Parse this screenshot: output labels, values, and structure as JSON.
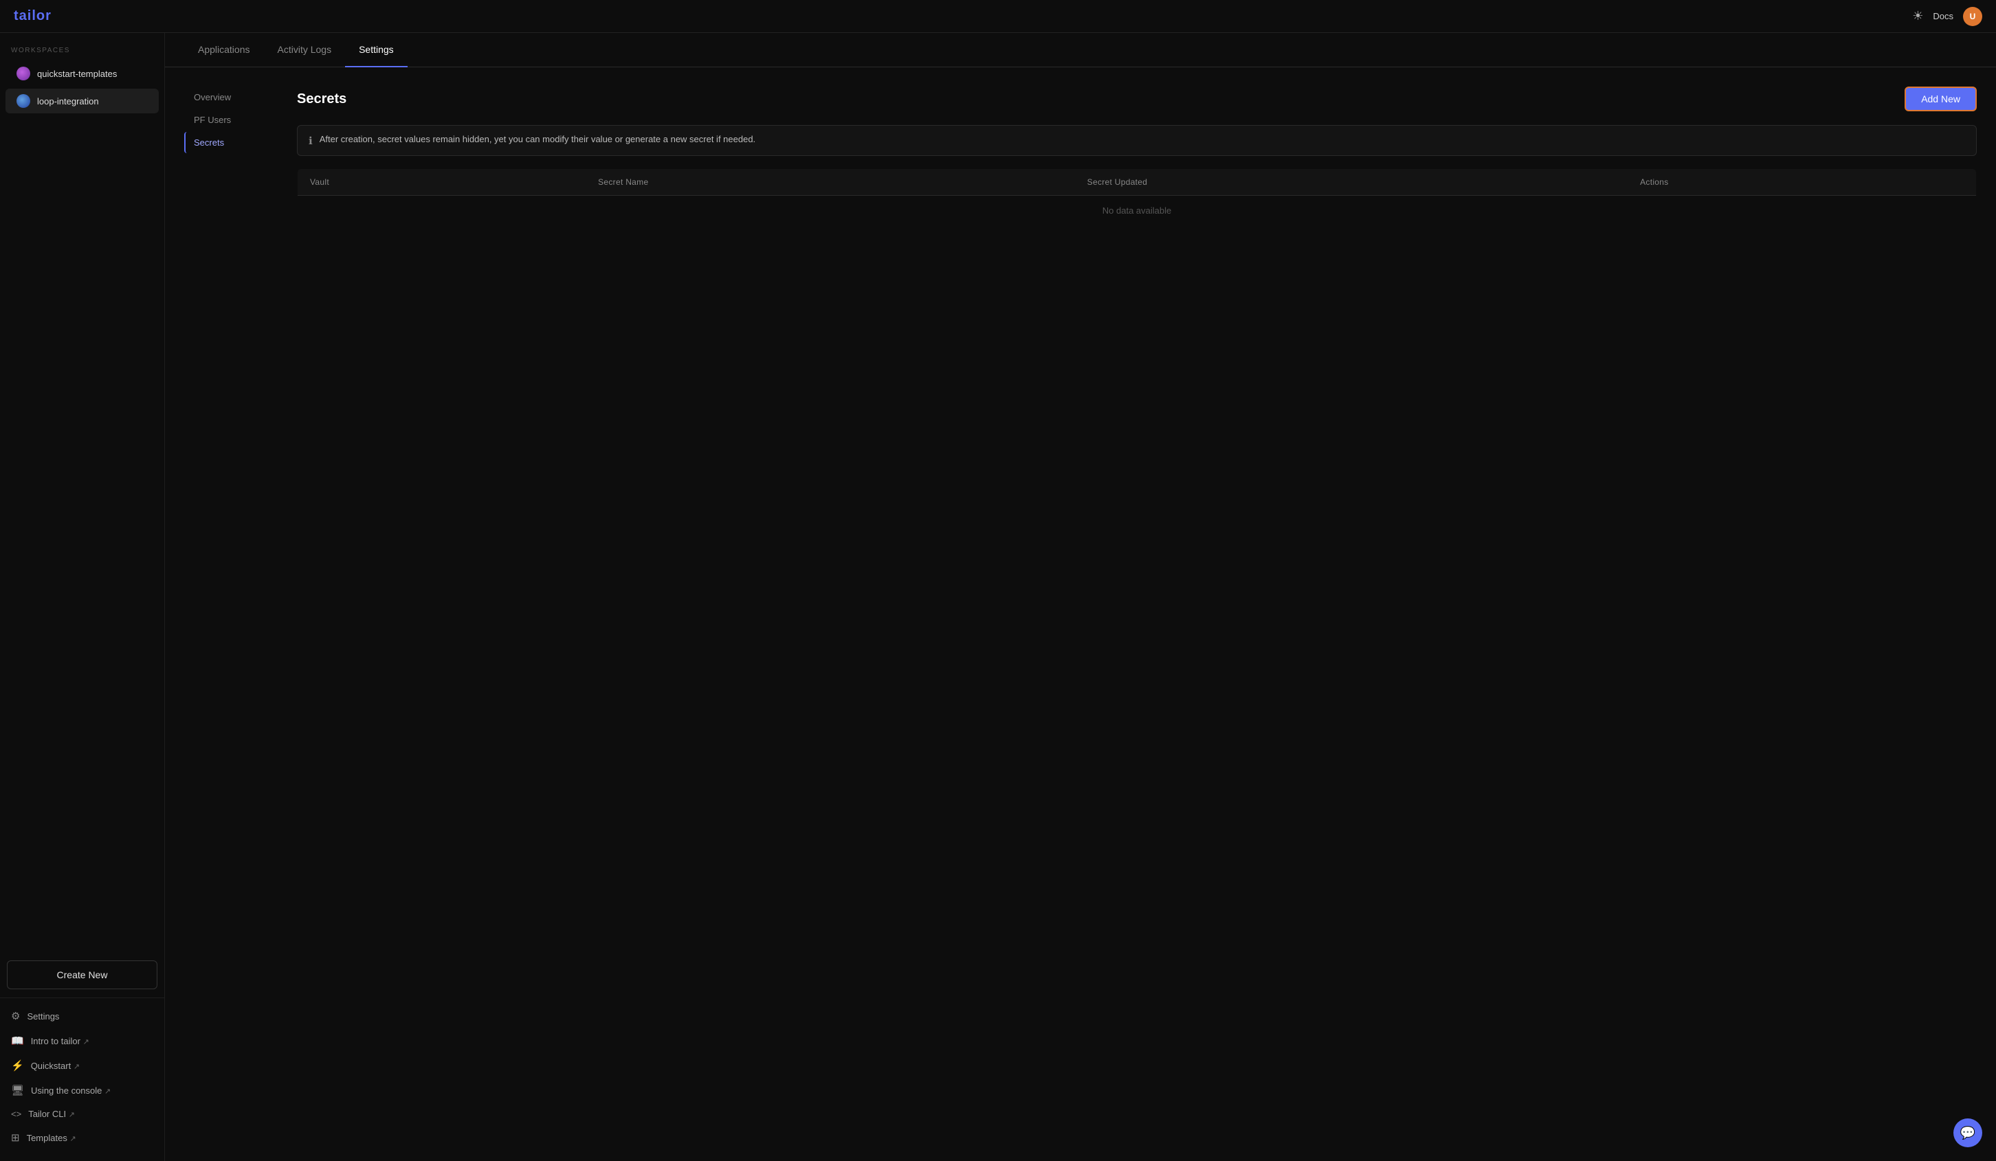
{
  "app": {
    "logo": "tailor",
    "docs_label": "Docs"
  },
  "topbar": {
    "theme_icon": "☀",
    "avatar_initials": "U"
  },
  "sidebar": {
    "section_label": "WORKSPACES",
    "workspaces": [
      {
        "id": "quickstart-templates",
        "label": "quickstart-templates",
        "icon_class": "gradient1",
        "active": false
      },
      {
        "id": "loop-integration",
        "label": "loop-integration",
        "icon_class": "gradient2",
        "active": true
      }
    ],
    "create_new_label": "Create New",
    "bottom_items": [
      {
        "id": "settings",
        "label": "Settings",
        "icon": "⚙"
      },
      {
        "id": "intro-to-tailor",
        "label": "Intro to tailor ↗",
        "icon": "📖"
      },
      {
        "id": "quickstart",
        "label": "Quickstart ↗",
        "icon": "⚡"
      },
      {
        "id": "using-the-console",
        "label": "Using the console ↗",
        "icon": "🖥"
      },
      {
        "id": "tailor-cli",
        "label": "Tailor CLI ↗",
        "icon": "⟨⟩"
      },
      {
        "id": "templates",
        "label": "Templates ↗",
        "icon": "⊞"
      }
    ]
  },
  "tabs": [
    {
      "id": "applications",
      "label": "Applications",
      "active": false
    },
    {
      "id": "activity-logs",
      "label": "Activity Logs",
      "active": false
    },
    {
      "id": "settings",
      "label": "Settings",
      "active": true
    }
  ],
  "sub_nav": [
    {
      "id": "overview",
      "label": "Overview",
      "active": false
    },
    {
      "id": "pf-users",
      "label": "PF Users",
      "active": false
    },
    {
      "id": "secrets",
      "label": "Secrets",
      "active": true
    }
  ],
  "main_panel": {
    "title": "Secrets",
    "add_new_label": "Add New",
    "info_text": "After creation, secret values remain hidden, yet you can modify their value or generate a new secret if needed.",
    "table": {
      "columns": [
        "Vault",
        "Secret Name",
        "Secret Updated",
        "Actions"
      ],
      "no_data_text": "No data available"
    }
  }
}
